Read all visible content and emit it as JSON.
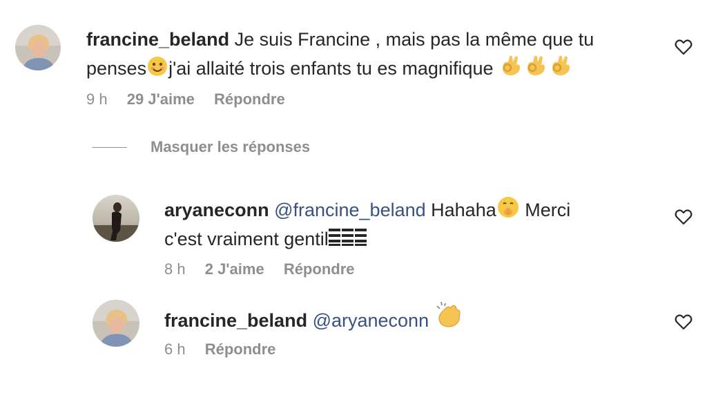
{
  "comments": [
    {
      "username": "francine_beland",
      "text_line1": "Je suis Francine , mais pas la même que tu",
      "text_line2_a": "penses",
      "text_line2_b": "j'ai allaité trois enfants tu es magnifique",
      "time": "9 h",
      "likes": "29 J'aime",
      "reply": "Répondre",
      "emoji_smile": "smiling-face-emoji",
      "emoji_ok": "ok-hand-emoji"
    }
  ],
  "replies_toggle": {
    "label": "Masquer les réponses"
  },
  "replies": [
    {
      "username": "aryaneconn",
      "mention": "@francine_beland",
      "text_a": "Hahaha",
      "text_b": "Merci",
      "text_c": "c'est vraiment gentil",
      "time": "8 h",
      "likes": "2 J'aime",
      "reply": "Répondre"
    },
    {
      "username": "francine_beland",
      "mention": "@aryaneconn",
      "time": "6 h",
      "reply": "Répondre"
    }
  ],
  "colors": {
    "text": "#262626",
    "meta": "#8e8e8e",
    "mention": "#385185"
  },
  "icons": {
    "like": "heart-icon"
  }
}
